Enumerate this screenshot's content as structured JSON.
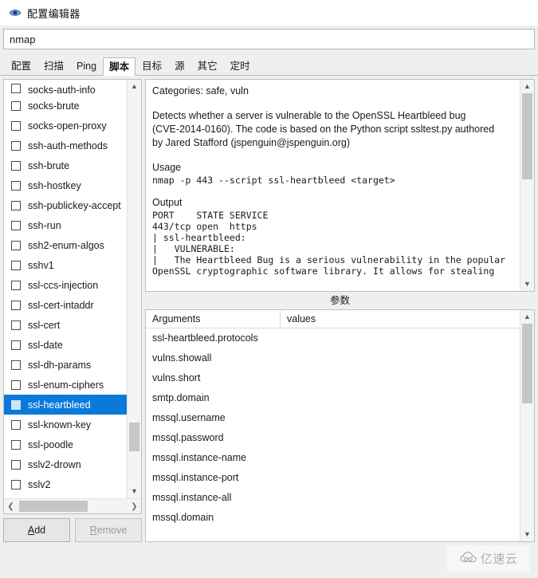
{
  "window": {
    "title": "配置编辑器",
    "icon": "eye-icon"
  },
  "command": {
    "value": "nmap",
    "placeholder": ""
  },
  "tabs": [
    {
      "label": "配置",
      "active": false
    },
    {
      "label": "扫描",
      "active": false
    },
    {
      "label": "Ping",
      "active": false
    },
    {
      "label": "脚本",
      "active": true
    },
    {
      "label": "目标",
      "active": false
    },
    {
      "label": "源",
      "active": false
    },
    {
      "label": "其它",
      "active": false
    },
    {
      "label": "定时",
      "active": false
    }
  ],
  "script_list": {
    "items": [
      {
        "label": "socks-auth-info",
        "checked": false,
        "selected": false,
        "clipped": true
      },
      {
        "label": "socks-brute",
        "checked": false,
        "selected": false
      },
      {
        "label": "socks-open-proxy",
        "checked": false,
        "selected": false
      },
      {
        "label": "ssh-auth-methods",
        "checked": false,
        "selected": false
      },
      {
        "label": "ssh-brute",
        "checked": false,
        "selected": false
      },
      {
        "label": "ssh-hostkey",
        "checked": false,
        "selected": false
      },
      {
        "label": "ssh-publickey-accept",
        "checked": false,
        "selected": false
      },
      {
        "label": "ssh-run",
        "checked": false,
        "selected": false
      },
      {
        "label": "ssh2-enum-algos",
        "checked": false,
        "selected": false
      },
      {
        "label": "sshv1",
        "checked": false,
        "selected": false
      },
      {
        "label": "ssl-ccs-injection",
        "checked": false,
        "selected": false
      },
      {
        "label": "ssl-cert-intaddr",
        "checked": false,
        "selected": false
      },
      {
        "label": "ssl-cert",
        "checked": false,
        "selected": false
      },
      {
        "label": "ssl-date",
        "checked": false,
        "selected": false
      },
      {
        "label": "ssl-dh-params",
        "checked": false,
        "selected": false
      },
      {
        "label": "ssl-enum-ciphers",
        "checked": false,
        "selected": false
      },
      {
        "label": "ssl-heartbleed",
        "checked": false,
        "selected": true
      },
      {
        "label": "ssl-known-key",
        "checked": false,
        "selected": false
      },
      {
        "label": "ssl-poodle",
        "checked": false,
        "selected": false
      },
      {
        "label": "sslv2-drown",
        "checked": false,
        "selected": false
      },
      {
        "label": "sslv2",
        "checked": false,
        "selected": false
      }
    ]
  },
  "buttons": {
    "add": {
      "before": "",
      "accel": "A",
      "after": "dd",
      "enabled": true
    },
    "remove": {
      "before": "",
      "accel": "R",
      "after": "emove",
      "enabled": false
    }
  },
  "description": {
    "categories": "Categories: safe, vuln",
    "body": "Detects whether a server is vulnerable to the OpenSSL Heartbleed bug\n(CVE-2014-0160). The code is based on the Python script ssltest.py authored\nby Jared Stafford (jspenguin@jspenguin.org)",
    "usage_heading": "Usage",
    "usage_command": "nmap -p 443 --script ssl-heartbleed <target>",
    "output_heading": "Output",
    "output_lines": "PORT    STATE SERVICE\n443/tcp open  https\n| ssl-heartbleed:\n|   VULNERABLE:\n|   The Heartbleed Bug is a serious vulnerability in the popular\nOpenSSL cryptographic software library. It allows for stealing"
  },
  "params": {
    "title": "参数",
    "columns": [
      "Arguments",
      "values"
    ],
    "rows": [
      {
        "argument": "ssl-heartbleed.protocols",
        "value": ""
      },
      {
        "argument": "vulns.showall",
        "value": ""
      },
      {
        "argument": "vulns.short",
        "value": ""
      },
      {
        "argument": "smtp.domain",
        "value": ""
      },
      {
        "argument": "mssql.username",
        "value": ""
      },
      {
        "argument": "mssql.password",
        "value": ""
      },
      {
        "argument": "mssql.instance-name",
        "value": ""
      },
      {
        "argument": "mssql.instance-port",
        "value": ""
      },
      {
        "argument": "mssql.instance-all",
        "value": ""
      },
      {
        "argument": "mssql.domain",
        "value": ""
      }
    ]
  },
  "watermark": {
    "text": "亿速云",
    "icon": "cloud-icon"
  },
  "colors": {
    "selection": "#0a7ada",
    "window_bg": "#efefef",
    "field_bg": "#ffffff",
    "border": "#bfbfbf"
  }
}
